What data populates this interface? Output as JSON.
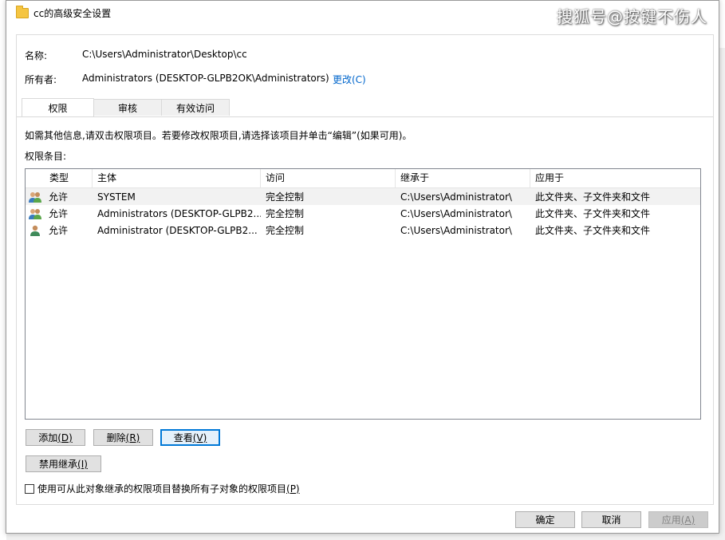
{
  "window": {
    "title": "cc的高级安全设置"
  },
  "watermark": "搜狐号@按键不伤人",
  "name_label": "名称:",
  "name_value": "C:\\Users\\Administrator\\Desktop\\cc",
  "owner_label": "所有者:",
  "owner_value": "Administrators (DESKTOP-GLPB2OK\\Administrators)",
  "owner_change_link": "更改(C)",
  "tabs": [
    {
      "label": "权限",
      "active": true
    },
    {
      "label": "审核",
      "active": false
    },
    {
      "label": "有效访问",
      "active": false
    }
  ],
  "hint": "如需其他信息,请双击权限项目。若要修改权限项目,请选择该项目并单击“编辑”(如果可用)。",
  "entries_label": "权限条目:",
  "columns": [
    "类型",
    "主体",
    "访问",
    "继承于",
    "应用于"
  ],
  "rows": [
    {
      "icon": "group-users-icon",
      "type": "允许",
      "principal": "SYSTEM",
      "access": "完全控制",
      "inherited": "C:\\Users\\Administrator\\",
      "applies": "此文件夹、子文件夹和文件"
    },
    {
      "icon": "group-users-icon",
      "type": "允许",
      "principal": "Administrators (DESKTOP-GLPB2...",
      "access": "完全控制",
      "inherited": "C:\\Users\\Administrator\\",
      "applies": "此文件夹、子文件夹和文件"
    },
    {
      "icon": "single-user-icon",
      "type": "允许",
      "principal": "Administrator (DESKTOP-GLPB2...",
      "access": "完全控制",
      "inherited": "C:\\Users\\Administrator\\",
      "applies": "此文件夹、子文件夹和文件"
    }
  ],
  "buttons": {
    "add": {
      "text": "添加",
      "key": "(D)"
    },
    "remove": {
      "text": "删除",
      "key": "(R)"
    },
    "view": {
      "text": "查看",
      "key": "(V)"
    },
    "disable_inheritance": {
      "text": "禁用继承",
      "key": "(I)"
    },
    "ok": "确定",
    "cancel": "取消",
    "apply": {
      "text": "应用",
      "key": "(A)"
    }
  },
  "replace_checkbox": {
    "label": "使用可从此对象继承的权限项目替换所有子对象的权限项目",
    "key": "(P)",
    "checked": false
  },
  "colors": {
    "accent": "#0078d7",
    "link": "#0066cc",
    "folder": "#f5c542"
  }
}
